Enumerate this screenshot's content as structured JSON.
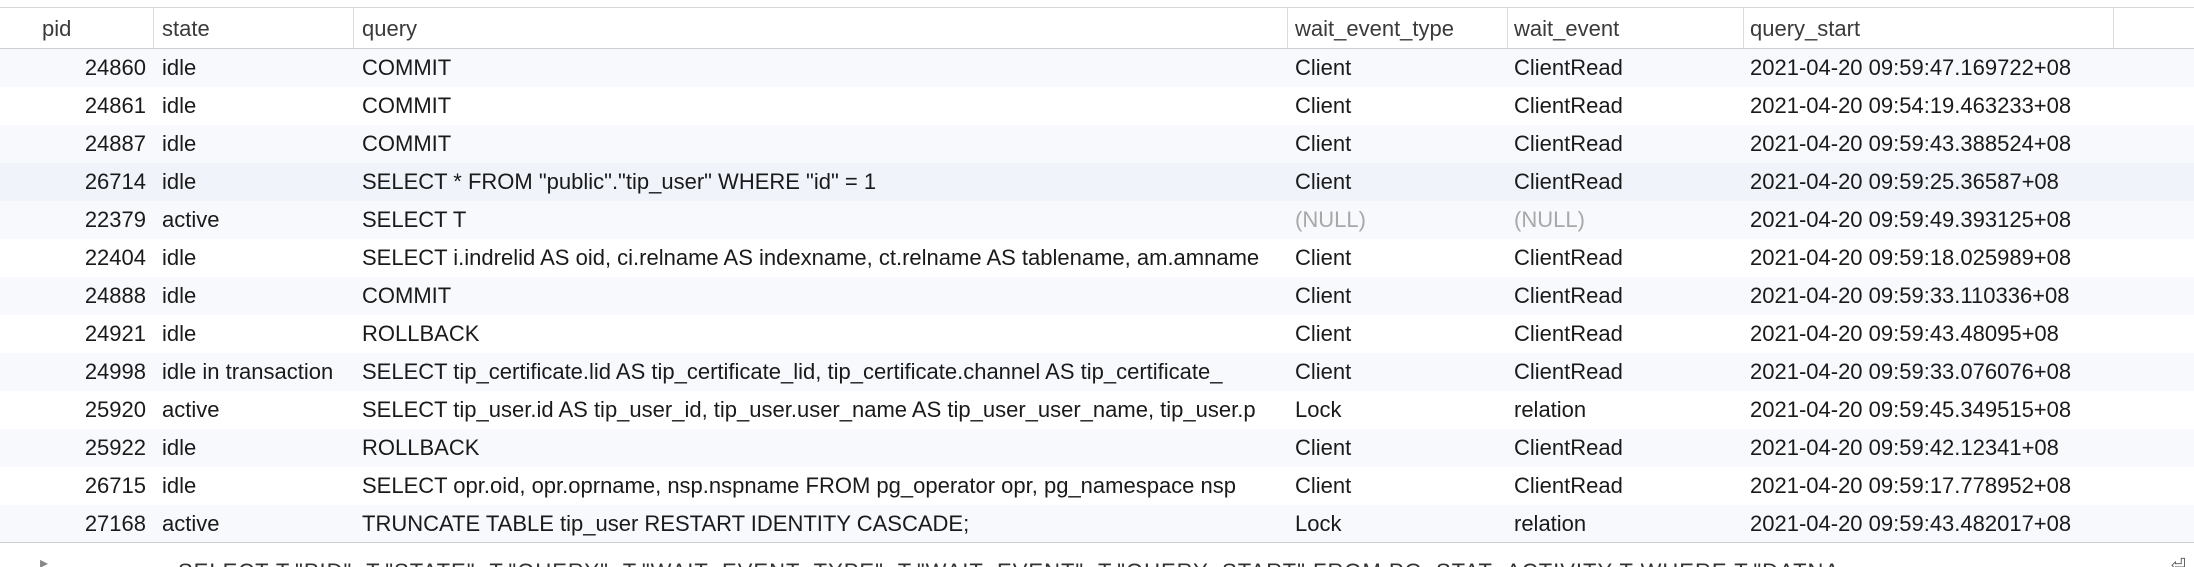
{
  "columns": [
    "pid",
    "state",
    "query",
    "wait_event_type",
    "wait_event",
    "query_start"
  ],
  "rows": [
    {
      "pid": "24860",
      "state": "idle",
      "query": "COMMIT",
      "wait_event_type": "Client",
      "wait_event": "ClientRead",
      "query_start": "2021-04-20 09:59:47.169722+08"
    },
    {
      "pid": "24861",
      "state": "idle",
      "query": "COMMIT",
      "wait_event_type": "Client",
      "wait_event": "ClientRead",
      "query_start": "2021-04-20 09:54:19.463233+08"
    },
    {
      "pid": "24887",
      "state": "idle",
      "query": "COMMIT",
      "wait_event_type": "Client",
      "wait_event": "ClientRead",
      "query_start": "2021-04-20 09:59:43.388524+08"
    },
    {
      "pid": "26714",
      "state": "idle",
      "query": "SELECT * FROM \"public\".\"tip_user\" WHERE \"id\" = 1",
      "wait_event_type": "Client",
      "wait_event": "ClientRead",
      "query_start": "2021-04-20 09:59:25.36587+08"
    },
    {
      "pid": "22379",
      "state": "active",
      "query": "SELECT T",
      "wait_event_type": "(NULL)",
      "wait_event": "(NULL)",
      "query_start": "2021-04-20 09:59:49.393125+08"
    },
    {
      "pid": "22404",
      "state": "idle",
      "query": "SELECT i.indrelid AS oid, ci.relname AS indexname, ct.relname AS tablename, am.amname",
      "wait_event_type": "Client",
      "wait_event": "ClientRead",
      "query_start": "2021-04-20 09:59:18.025989+08"
    },
    {
      "pid": "24888",
      "state": "idle",
      "query": "COMMIT",
      "wait_event_type": "Client",
      "wait_event": "ClientRead",
      "query_start": "2021-04-20 09:59:33.110336+08"
    },
    {
      "pid": "24921",
      "state": "idle",
      "query": "ROLLBACK",
      "wait_event_type": "Client",
      "wait_event": "ClientRead",
      "query_start": "2021-04-20 09:59:43.48095+08"
    },
    {
      "pid": "24998",
      "state": "idle in transaction",
      "query": "SELECT tip_certificate.lid AS tip_certificate_lid, tip_certificate.channel AS tip_certificate_",
      "wait_event_type": "Client",
      "wait_event": "ClientRead",
      "query_start": "2021-04-20 09:59:33.076076+08"
    },
    {
      "pid": "25920",
      "state": "active",
      "query": "SELECT tip_user.id AS tip_user_id, tip_user.user_name AS tip_user_user_name, tip_user.p",
      "wait_event_type": "Lock",
      "wait_event": "relation",
      "query_start": "2021-04-20 09:59:45.349515+08"
    },
    {
      "pid": "25922",
      "state": "idle",
      "query": "ROLLBACK",
      "wait_event_type": "Client",
      "wait_event": "ClientRead",
      "query_start": "2021-04-20 09:59:42.12341+08"
    },
    {
      "pid": "26715",
      "state": "idle",
      "query": "SELECT opr.oid, opr.oprname, nsp.nspname FROM pg_operator opr, pg_namespace nsp",
      "wait_event_type": "Client",
      "wait_event": "ClientRead",
      "query_start": "2021-04-20 09:59:17.778952+08"
    },
    {
      "pid": "27168",
      "state": "active",
      "query": "TRUNCATE TABLE tip_user RESTART IDENTITY CASCADE;",
      "wait_event_type": "Lock",
      "wait_event": "relation",
      "query_start": "2021-04-20 09:59:43.482017+08"
    }
  ],
  "footer": {
    "sql_text": "SELECT T.\"PID\", T.\"STATE\", T.\"QUERY\", T.\"WAIT_EVENT_TYPE\", T.\"WAIT_EVENT\", T.\"QUERY_START\" FROM PG_STAT_ACTIVITY T WHERE T.\"DATNA"
  },
  "colors": {
    "row_alt": "#f7f9fc",
    "null_text": "#a8a8a8",
    "header_border": "#cfcfcf"
  }
}
